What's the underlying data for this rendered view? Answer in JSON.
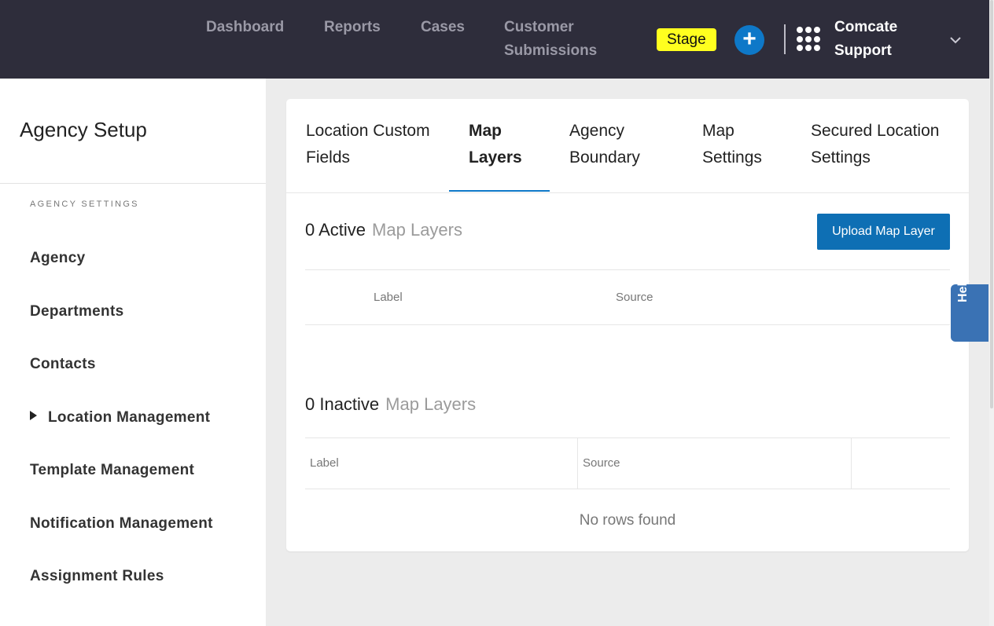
{
  "topnav": {
    "links": [
      "Dashboard",
      "Reports",
      "Cases",
      "Customer Submissions"
    ],
    "environment_badge": "Stage",
    "add_button_icon": "plus-icon",
    "apps_icon": "grid-icon",
    "org_name": "Comcate Support",
    "menu_icon": "chevron-down-icon"
  },
  "sidebar": {
    "title": "Agency Setup",
    "section_label": "AGENCY SETTINGS",
    "items": [
      "Agency",
      "Departments",
      "Contacts",
      "Location Management",
      "Template Management",
      "Notification Management",
      "Assignment Rules"
    ]
  },
  "tabs": [
    "Location Custom Fields",
    "Map Layers",
    "Agency Boundary",
    "Map Settings",
    "Secured Location Settings"
  ],
  "active_tab": "Map Layers",
  "active_section": {
    "count": "0 Active",
    "label": "Map Layers",
    "upload_button": "Upload Map Layer",
    "columns": [
      "Label",
      "Source"
    ]
  },
  "inactive_section": {
    "count": "0 Inactive",
    "label": "Map Layers",
    "columns": [
      "Label",
      "Source"
    ],
    "empty_message": "No rows found"
  },
  "help": {
    "label": "Help"
  },
  "colors": {
    "topbar": "#2e2d3b",
    "accent": "#0e78c8",
    "stage_badge": "#ffff1f",
    "help_tab": "#3a72b4"
  }
}
